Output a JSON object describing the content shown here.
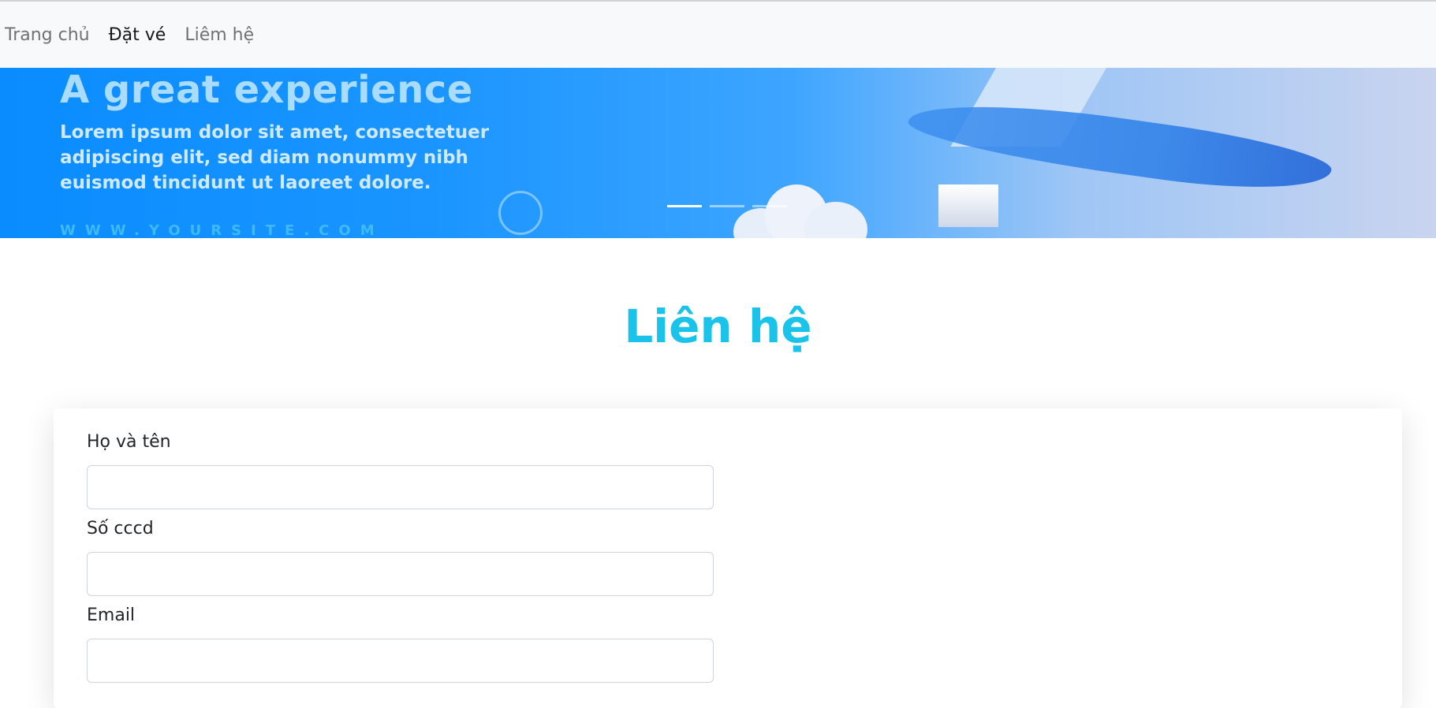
{
  "nav": {
    "items": [
      {
        "label": "Trang chủ",
        "active": false
      },
      {
        "label": "Đặt vé",
        "active": true
      },
      {
        "label": "Liêm hệ",
        "active": false
      }
    ]
  },
  "carousel": {
    "title": "A great experience",
    "text": "Lorem ipsum dolor sit amet, consectetuer adipiscing elit, sed diam nonummy nibh euismod tincidunt ut laoreet dolore.",
    "url": "WWW.YOURSITE.COM",
    "slide_count": 3,
    "active_slide": 1
  },
  "page": {
    "heading": "Liên hệ"
  },
  "form": {
    "fields": [
      {
        "label": "Họ và tên",
        "value": "",
        "placeholder": ""
      },
      {
        "label": "Số cccd",
        "value": "",
        "placeholder": ""
      },
      {
        "label": "Email",
        "value": "",
        "placeholder": ""
      }
    ]
  },
  "colors": {
    "heading": "#19c3ea",
    "navbar_bg": "#f8f9fa",
    "carousel_blue": "#0a8cff"
  }
}
